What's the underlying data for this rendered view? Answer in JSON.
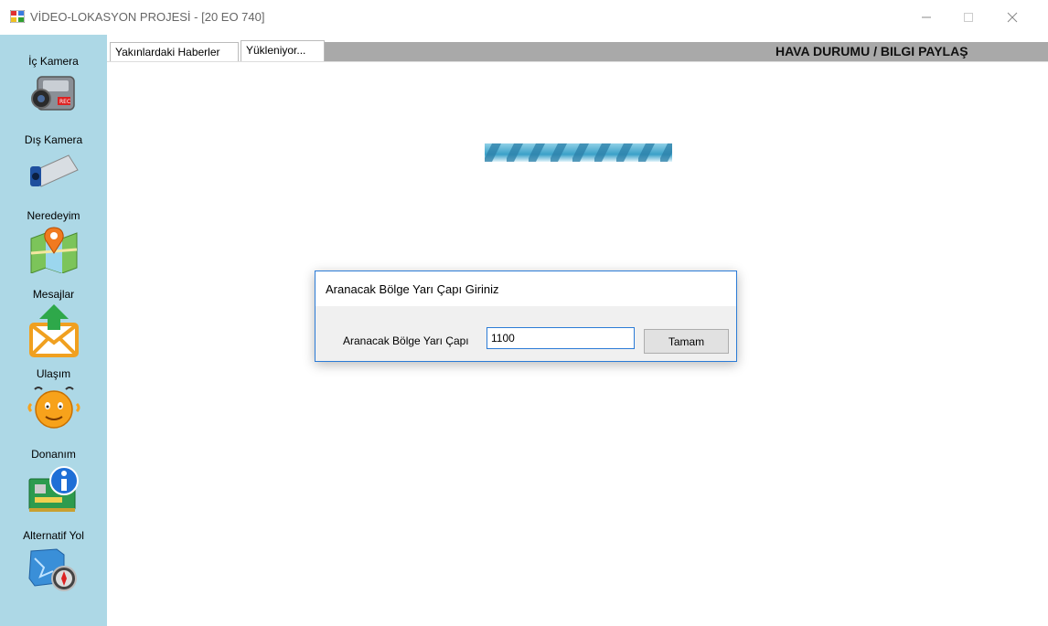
{
  "window": {
    "title": "VİDEO-LOKASYON PROJESİ - [20 EO 740]",
    "icon": "app-window-icon",
    "controls": [
      "minimize",
      "maximize",
      "close"
    ]
  },
  "sidebar": {
    "background": "#add8e6",
    "items": [
      {
        "label": "İç Kamera",
        "icon": "camcorder-icon"
      },
      {
        "label": "Dış Kamera",
        "icon": "security-camera-icon"
      },
      {
        "label": "Neredeyim",
        "icon": "map-pin-icon"
      },
      {
        "label": "Mesajlar",
        "icon": "mail-upload-icon"
      },
      {
        "label": "Ulaşım",
        "icon": "smiley-icon"
      },
      {
        "label": "Donanım",
        "icon": "hardware-info-icon"
      },
      {
        "label": "Alternatif Yol",
        "icon": "map-compass-icon"
      }
    ]
  },
  "tabs": [
    {
      "label": "Yakınlardaki Haberler"
    },
    {
      "label": "Yükleniyor..."
    }
  ],
  "weather_banner": {
    "label": "HAVA DURUMU / BILGI PAYLAŞ"
  },
  "loader": {
    "icon": "loading-bar-icon"
  },
  "dialog": {
    "title": "Aranacak Bölge Yarı Çapı Giriniz",
    "field_label": "Aranacak Bölge Yarı Çapı",
    "field_value": "1100",
    "ok_button": "Tamam"
  }
}
